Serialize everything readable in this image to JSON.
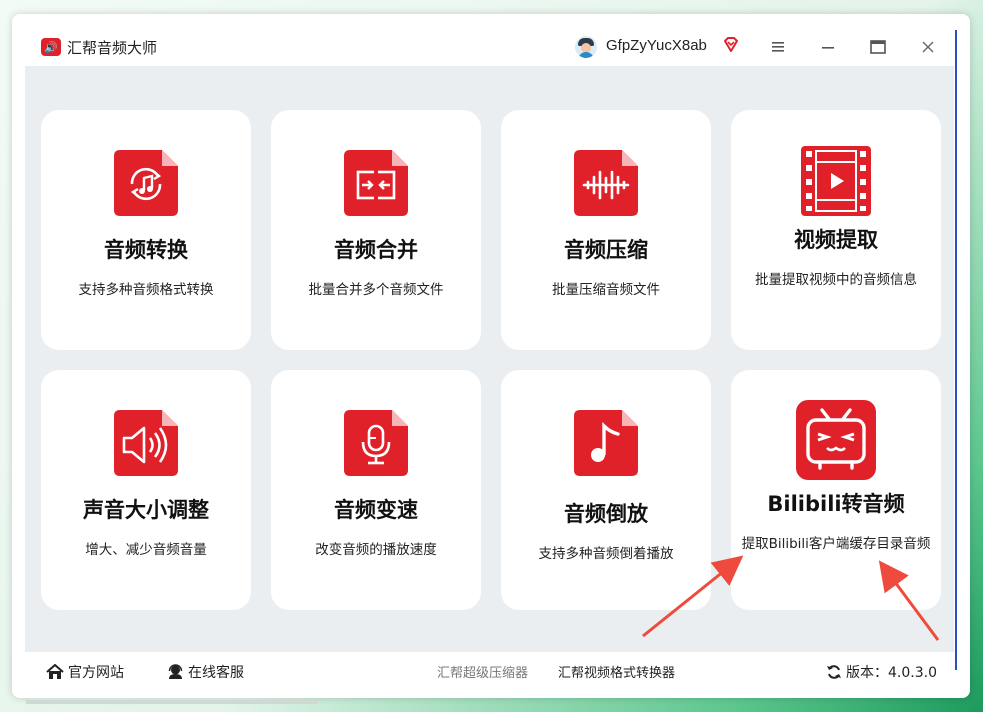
{
  "app": {
    "title": "汇帮音频大师",
    "username": "GfpZyYucX8ab",
    "accent_color": "#e0212a"
  },
  "window_controls": {
    "menu_icon": "hamburger-icon",
    "minimize_icon": "minimize-icon",
    "maximize_icon": "maximize-icon",
    "close_icon": "close-icon"
  },
  "cards": [
    {
      "title": "音频转换",
      "desc": "支持多种音频格式转换",
      "icon": "audio-convert-icon"
    },
    {
      "title": "音频合并",
      "desc": "批量合并多个音频文件",
      "icon": "audio-merge-icon"
    },
    {
      "title": "音频压缩",
      "desc": "批量压缩音频文件",
      "icon": "audio-compress-icon"
    },
    {
      "title": "视频提取",
      "desc": "批量提取视频中的音频信息",
      "icon": "video-extract-icon"
    },
    {
      "title": "声音大小调整",
      "desc": "增大、减少音频音量",
      "icon": "volume-adjust-icon"
    },
    {
      "title": "音频变速",
      "desc": "改变音频的播放速度",
      "icon": "audio-speed-icon"
    },
    {
      "title": "音频倒放",
      "desc": "支持多种音频倒着播放",
      "icon": "audio-reverse-icon"
    },
    {
      "title": "Bilibili转音频",
      "desc": "提取Bilibili客户端缓存目录音频",
      "icon": "bilibili-tv-icon"
    }
  ],
  "footer": {
    "website": "官方网站",
    "support": "在线客服",
    "link_compressor": "汇帮超级压缩器",
    "link_converter": "汇帮视频格式转换器",
    "version_label": "版本：4.0.3.0"
  }
}
